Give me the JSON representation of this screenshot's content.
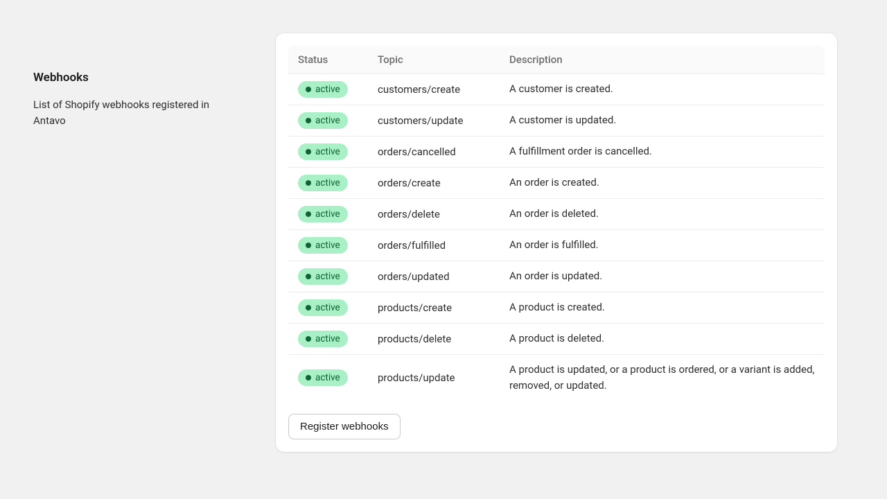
{
  "sidebar": {
    "title": "Webhooks",
    "subtitle": "List of Shopify webhooks registered in Antavo"
  },
  "table": {
    "headers": {
      "status": "Status",
      "topic": "Topic",
      "description": "Description"
    },
    "status_label": "active",
    "rows": [
      {
        "topic": "customers/create",
        "description": "A customer is created."
      },
      {
        "topic": "customers/update",
        "description": "A customer is updated."
      },
      {
        "topic": "orders/cancelled",
        "description": "A fulfillment order is cancelled."
      },
      {
        "topic": "orders/create",
        "description": "An order is created."
      },
      {
        "topic": "orders/delete",
        "description": "An order is deleted."
      },
      {
        "topic": "orders/fulfilled",
        "description": "An order is fulfilled."
      },
      {
        "topic": "orders/updated",
        "description": "An order is updated."
      },
      {
        "topic": "products/create",
        "description": "A product is created."
      },
      {
        "topic": "products/delete",
        "description": "A product is deleted."
      },
      {
        "topic": "products/update",
        "description": "A product is updated, or a product is ordered, or a variant is added, removed, or updated."
      }
    ]
  },
  "actions": {
    "register_label": "Register webhooks"
  }
}
